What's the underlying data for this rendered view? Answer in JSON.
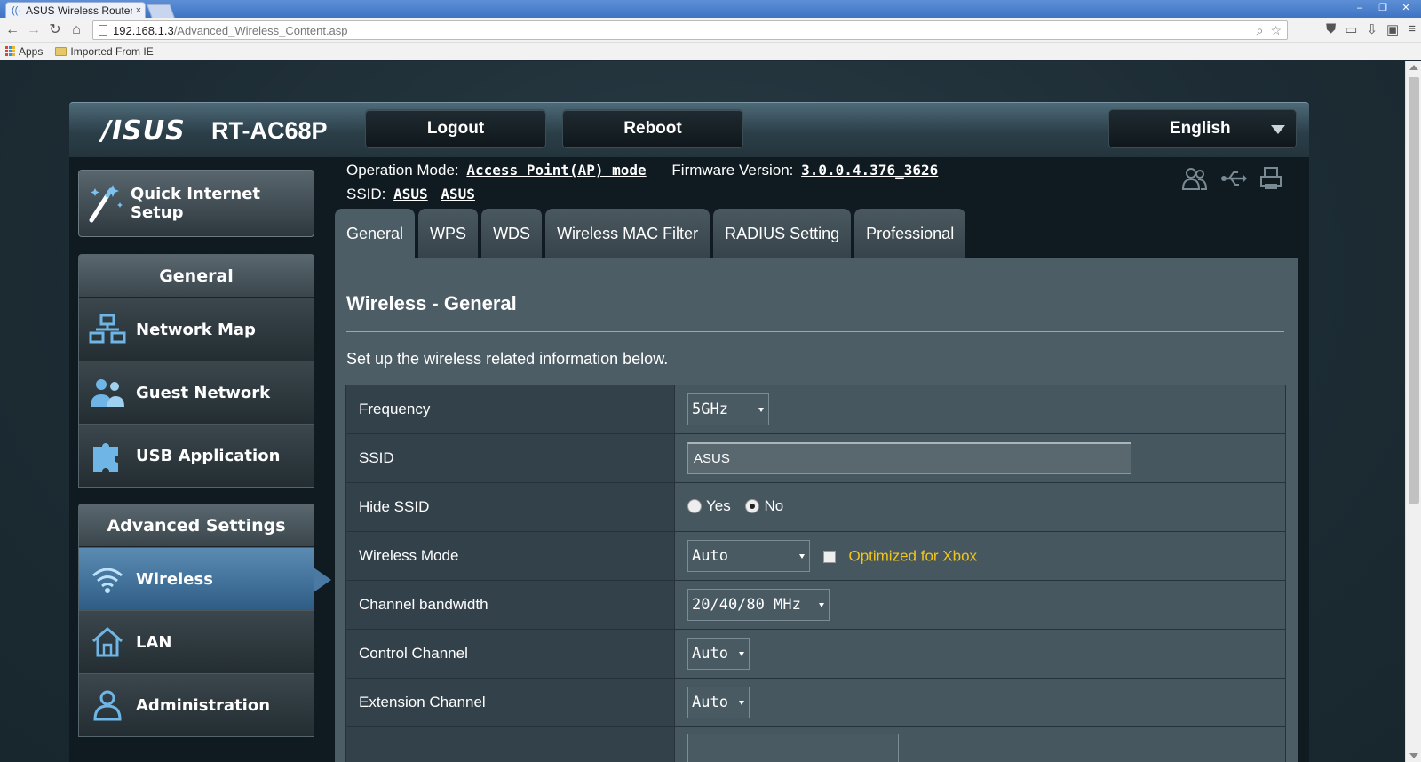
{
  "browser": {
    "tab_title": "ASUS Wireless Router",
    "tab_close": "×",
    "url_host": "192.168.1.3",
    "url_path": "/Advanced_Wireless_Content.asp",
    "bookmarks": [
      "Apps",
      "Imported From IE"
    ],
    "window_buttons": [
      "‒",
      "❐",
      "✕"
    ]
  },
  "header": {
    "logo": "/ISUS",
    "model": "RT-AC68P",
    "logout_label": "Logout",
    "reboot_label": "Reboot",
    "language": "English"
  },
  "info": {
    "operation_mode_label": "Operation Mode:",
    "operation_mode_value": "Access Point(AP) mode",
    "firmware_label": "Firmware Version:",
    "firmware_value": "3.0.0.4.376_3626",
    "ssid_label": "SSID:",
    "ssid_values": [
      "ASUS",
      "ASUS"
    ]
  },
  "sidebar": {
    "quick_setup": "Quick Internet Setup",
    "general_heading": "General",
    "general_items": [
      "Network Map",
      "Guest Network",
      "USB Application"
    ],
    "advanced_heading": "Advanced Settings",
    "advanced_items": [
      "Wireless",
      "LAN",
      "Administration"
    ],
    "active_item": "Wireless"
  },
  "tabs": [
    "General",
    "WPS",
    "WDS",
    "Wireless MAC Filter",
    "RADIUS Setting",
    "Professional"
  ],
  "active_tab": "General",
  "panel": {
    "title": "Wireless - General",
    "description": "Set up the wireless related information below."
  },
  "form": {
    "rows": [
      {
        "label": "Frequency",
        "value": "5GHz"
      },
      {
        "label": "SSID",
        "value": "ASUS"
      },
      {
        "label": "Hide SSID",
        "options": [
          "Yes",
          "No"
        ],
        "selected": "No"
      },
      {
        "label": "Wireless Mode",
        "value": "Auto",
        "checkbox_label": "Optimized for Xbox",
        "checkbox_checked": false
      },
      {
        "label": "Channel bandwidth",
        "value": "20/40/80 MHz"
      },
      {
        "label": "Control Channel",
        "value": "Auto"
      },
      {
        "label": "Extension Channel",
        "value": "Auto"
      }
    ]
  },
  "colors": {
    "accent_xbox": "#f0c419",
    "active_menu": "#4a7aa3",
    "panel_bg": "#4c5d66"
  }
}
